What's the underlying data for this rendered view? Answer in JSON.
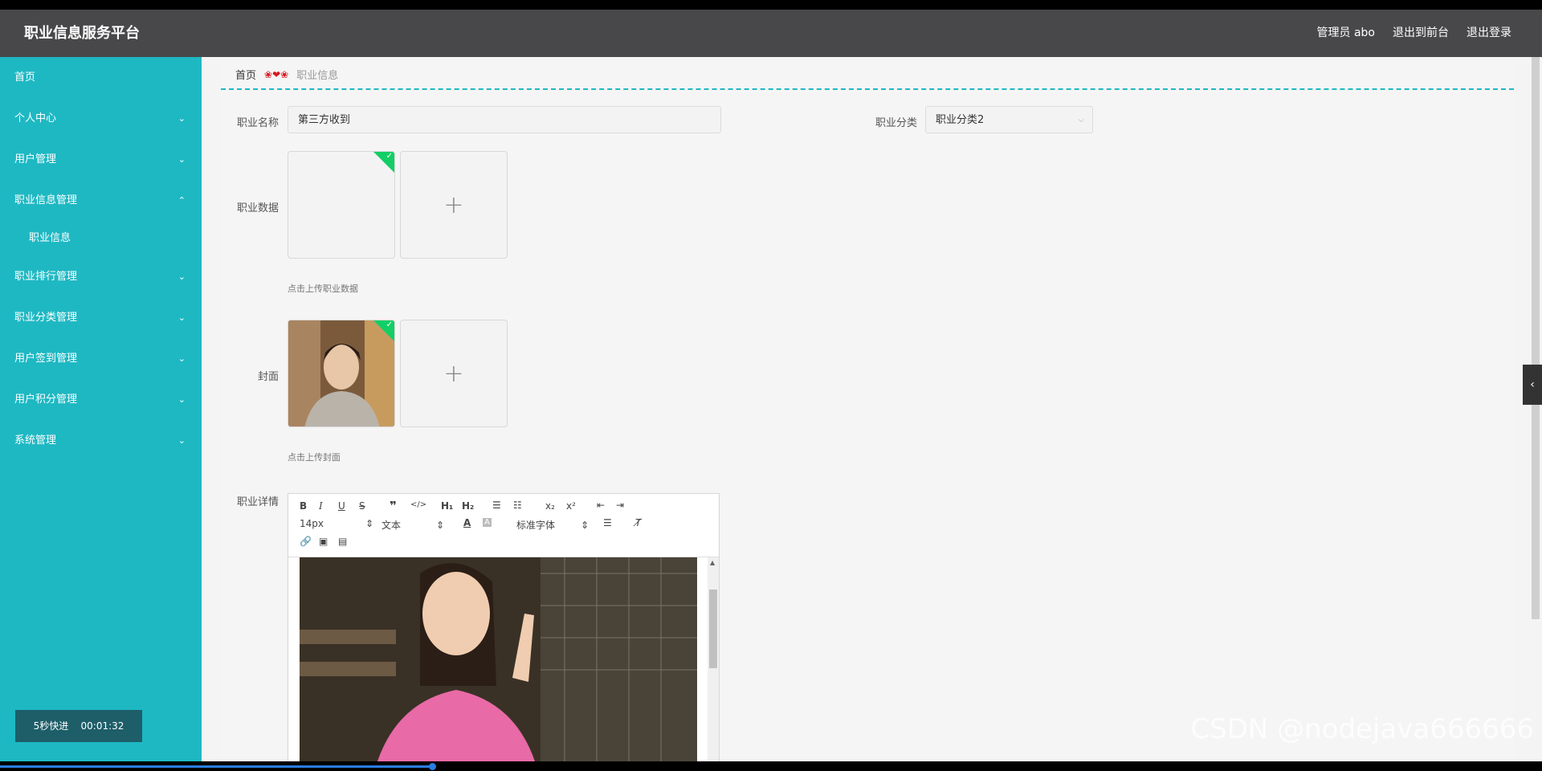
{
  "header": {
    "title": "职业信息服务平台",
    "admin": "管理员 abo",
    "to_front": "退出到前台",
    "logout": "退出登录"
  },
  "sidebar": {
    "items": [
      {
        "label": "首页",
        "chevron": ""
      },
      {
        "label": "个人中心",
        "chevron": "⌄"
      },
      {
        "label": "用户管理",
        "chevron": "⌄"
      },
      {
        "label": "职业信息管理",
        "chevron": "⌃"
      },
      {
        "label": "职业信息",
        "chevron": ""
      },
      {
        "label": "职业排行管理",
        "chevron": "⌄"
      },
      {
        "label": "职业分类管理",
        "chevron": "⌄"
      },
      {
        "label": "用户签到管理",
        "chevron": "⌄"
      },
      {
        "label": "用户积分管理",
        "chevron": "⌄"
      },
      {
        "label": "系统管理",
        "chevron": "⌄"
      }
    ],
    "timer_label": "5秒快进",
    "timer_value": "00:01:32"
  },
  "breadcrumb": {
    "home": "首页",
    "separator": "❀❤❀",
    "current": "职业信息"
  },
  "form": {
    "name_label": "职业名称",
    "name_value": "第三方收到",
    "category_label": "职业分类",
    "category_value": "职业分类2",
    "data_label": "职业数据",
    "data_hint": "点击上传职业数据",
    "cover_label": "封面",
    "cover_hint": "点击上传封面",
    "detail_label": "职业详情"
  },
  "editor": {
    "font_size": "14px",
    "block_type": "文本",
    "font_family": "标准字体"
  },
  "watermark": "CSDN @nodejava666666",
  "progress": 0.28,
  "colors": {
    "sidebar": "#1eb8c3",
    "topbar": "#48484a",
    "success": "#13ce66"
  }
}
